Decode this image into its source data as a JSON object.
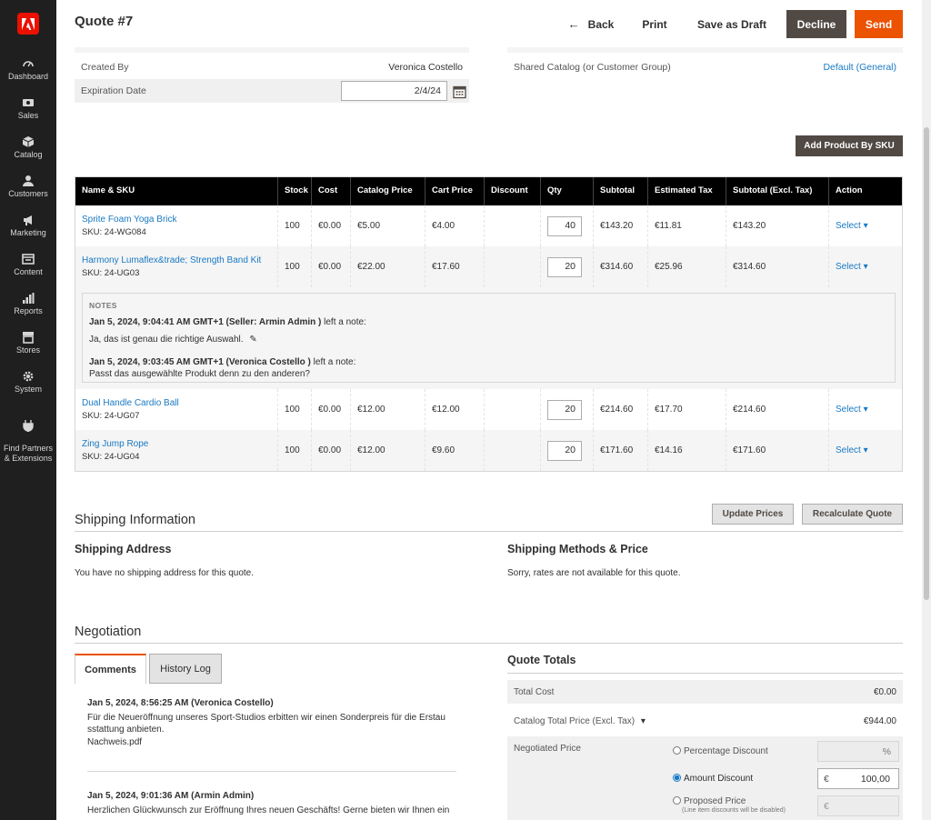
{
  "sidebar": {
    "items": [
      {
        "label": "Dashboard",
        "icon": "dashboard-icon"
      },
      {
        "label": "Sales",
        "icon": "dollar-icon"
      },
      {
        "label": "Catalog",
        "icon": "cube-icon"
      },
      {
        "label": "Customers",
        "icon": "users-icon"
      },
      {
        "label": "Marketing",
        "icon": "megaphone-icon"
      },
      {
        "label": "Content",
        "icon": "layout-icon"
      },
      {
        "label": "Reports",
        "icon": "bar-chart-icon"
      },
      {
        "label": "Stores",
        "icon": "storefront-icon"
      },
      {
        "label": "System",
        "icon": "gear-icon"
      },
      {
        "label": "Find Partners\n& Extensions",
        "icon": "plug-icon"
      }
    ]
  },
  "header": {
    "title": "Quote #7",
    "back": "Back",
    "print": "Print",
    "save_draft": "Save as Draft",
    "decline": "Decline",
    "send": "Send"
  },
  "info": {
    "created_by_label": "Created By",
    "created_by_value": "Veronica Costello",
    "expiration_label": "Expiration Date",
    "expiration_value": "2/4/24",
    "shared_catalog_label": "Shared Catalog (or Customer Group)",
    "shared_catalog_value": "Default (General)"
  },
  "add_by_sku": "Add Product By SKU",
  "table": {
    "headers": [
      "Name & SKU",
      "Stock",
      "Cost",
      "Catalog Price",
      "Cart Price",
      "Discount",
      "Qty",
      "Subtotal",
      "Estimated Tax",
      "Subtotal (Excl. Tax)",
      "Action"
    ],
    "rows": [
      {
        "name": "Sprite Foam Yoga Brick",
        "sku": "SKU: 24-WG084",
        "stock": "100",
        "cost": "€0.00",
        "catalog": "€5.00",
        "cart": "€4.00",
        "discount": "",
        "qty": "40",
        "subtotal": "€143.20",
        "tax": "€11.81",
        "excl": "€143.20",
        "action": "Select"
      },
      {
        "name": "Harmony Lumaflex&trade; Strength Band Kit",
        "sku": "SKU: 24-UG03",
        "stock": "100",
        "cost": "€0.00",
        "catalog": "€22.00",
        "cart": "€17.60",
        "discount": "",
        "qty": "20",
        "subtotal": "€314.60",
        "tax": "€25.96",
        "excl": "€314.60",
        "action": "Select"
      },
      {
        "name": "Dual Handle Cardio Ball",
        "sku": "SKU: 24-UG07",
        "stock": "100",
        "cost": "€0.00",
        "catalog": "€12.00",
        "cart": "€12.00",
        "discount": "",
        "qty": "20",
        "subtotal": "€214.60",
        "tax": "€17.70",
        "excl": "€214.60",
        "action": "Select"
      },
      {
        "name": "Zing Jump Rope",
        "sku": "SKU: 24-UG04",
        "stock": "100",
        "cost": "€0.00",
        "catalog": "€12.00",
        "cart": "€9.60",
        "discount": "",
        "qty": "20",
        "subtotal": "€171.60",
        "tax": "€14.16",
        "excl": "€171.60",
        "action": "Select"
      }
    ],
    "notes": {
      "title": "NOTES",
      "note1_head": "Jan 5, 2024, 9:04:41 AM GMT+1 (Seller: Armin Admin )",
      "note1_tail": " left a note:",
      "note1_text": "Ja, das ist genau die richtige Auswahl.",
      "note2_head": "Jan 5, 2024, 9:03:45 AM GMT+1 (Veronica Costello )",
      "note2_tail": " left a note:",
      "note2_text": "Passt das ausgewählte Produkt denn zu den anderen?"
    }
  },
  "buttons": {
    "update_prices": "Update Prices",
    "recalculate": "Recalculate Quote"
  },
  "shipping": {
    "title": "Shipping Information",
    "address_title": "Shipping Address",
    "address_text": "You have no shipping address for this quote.",
    "methods_title": "Shipping Methods & Price",
    "methods_text": "Sorry, rates are not available for this quote."
  },
  "negotiation": {
    "title": "Negotiation",
    "tab_comments": "Comments",
    "tab_history": "History Log",
    "c1_head": "Jan 5, 2024, 8:56:25 AM (Veronica Costello)",
    "c1_line1": "Für die Neueröffnung unseres Sport-Studios erbitten wir einen Sonderpreis für die Erstau",
    "c1_line2": "sstattung anbieten.",
    "c1_file": "Nachweis.pdf",
    "c2_head": "Jan 5, 2024, 9:01:36 AM (Armin Admin)",
    "c2_line1": "Herzlichen Glückwunsch zur Eröffnung Ihres neuen Geschäfts! Gerne bieten wir Ihnen ein"
  },
  "totals": {
    "title": "Quote Totals",
    "total_cost_label": "Total Cost",
    "total_cost_value": "€0.00",
    "catalog_total_label": "Catalog Total Price (Excl. Tax)",
    "catalog_total_value": "€944.00",
    "negotiated_label": "Negotiated Price",
    "pct_label": "Percentage Discount",
    "pct_unit": "%",
    "amount_label": "Amount Discount",
    "amount_currency": "€",
    "amount_value": "100,00",
    "proposed_label": "Proposed Price",
    "proposed_note": "(Line item discounts will be disabled)",
    "proposed_currency": "€"
  }
}
